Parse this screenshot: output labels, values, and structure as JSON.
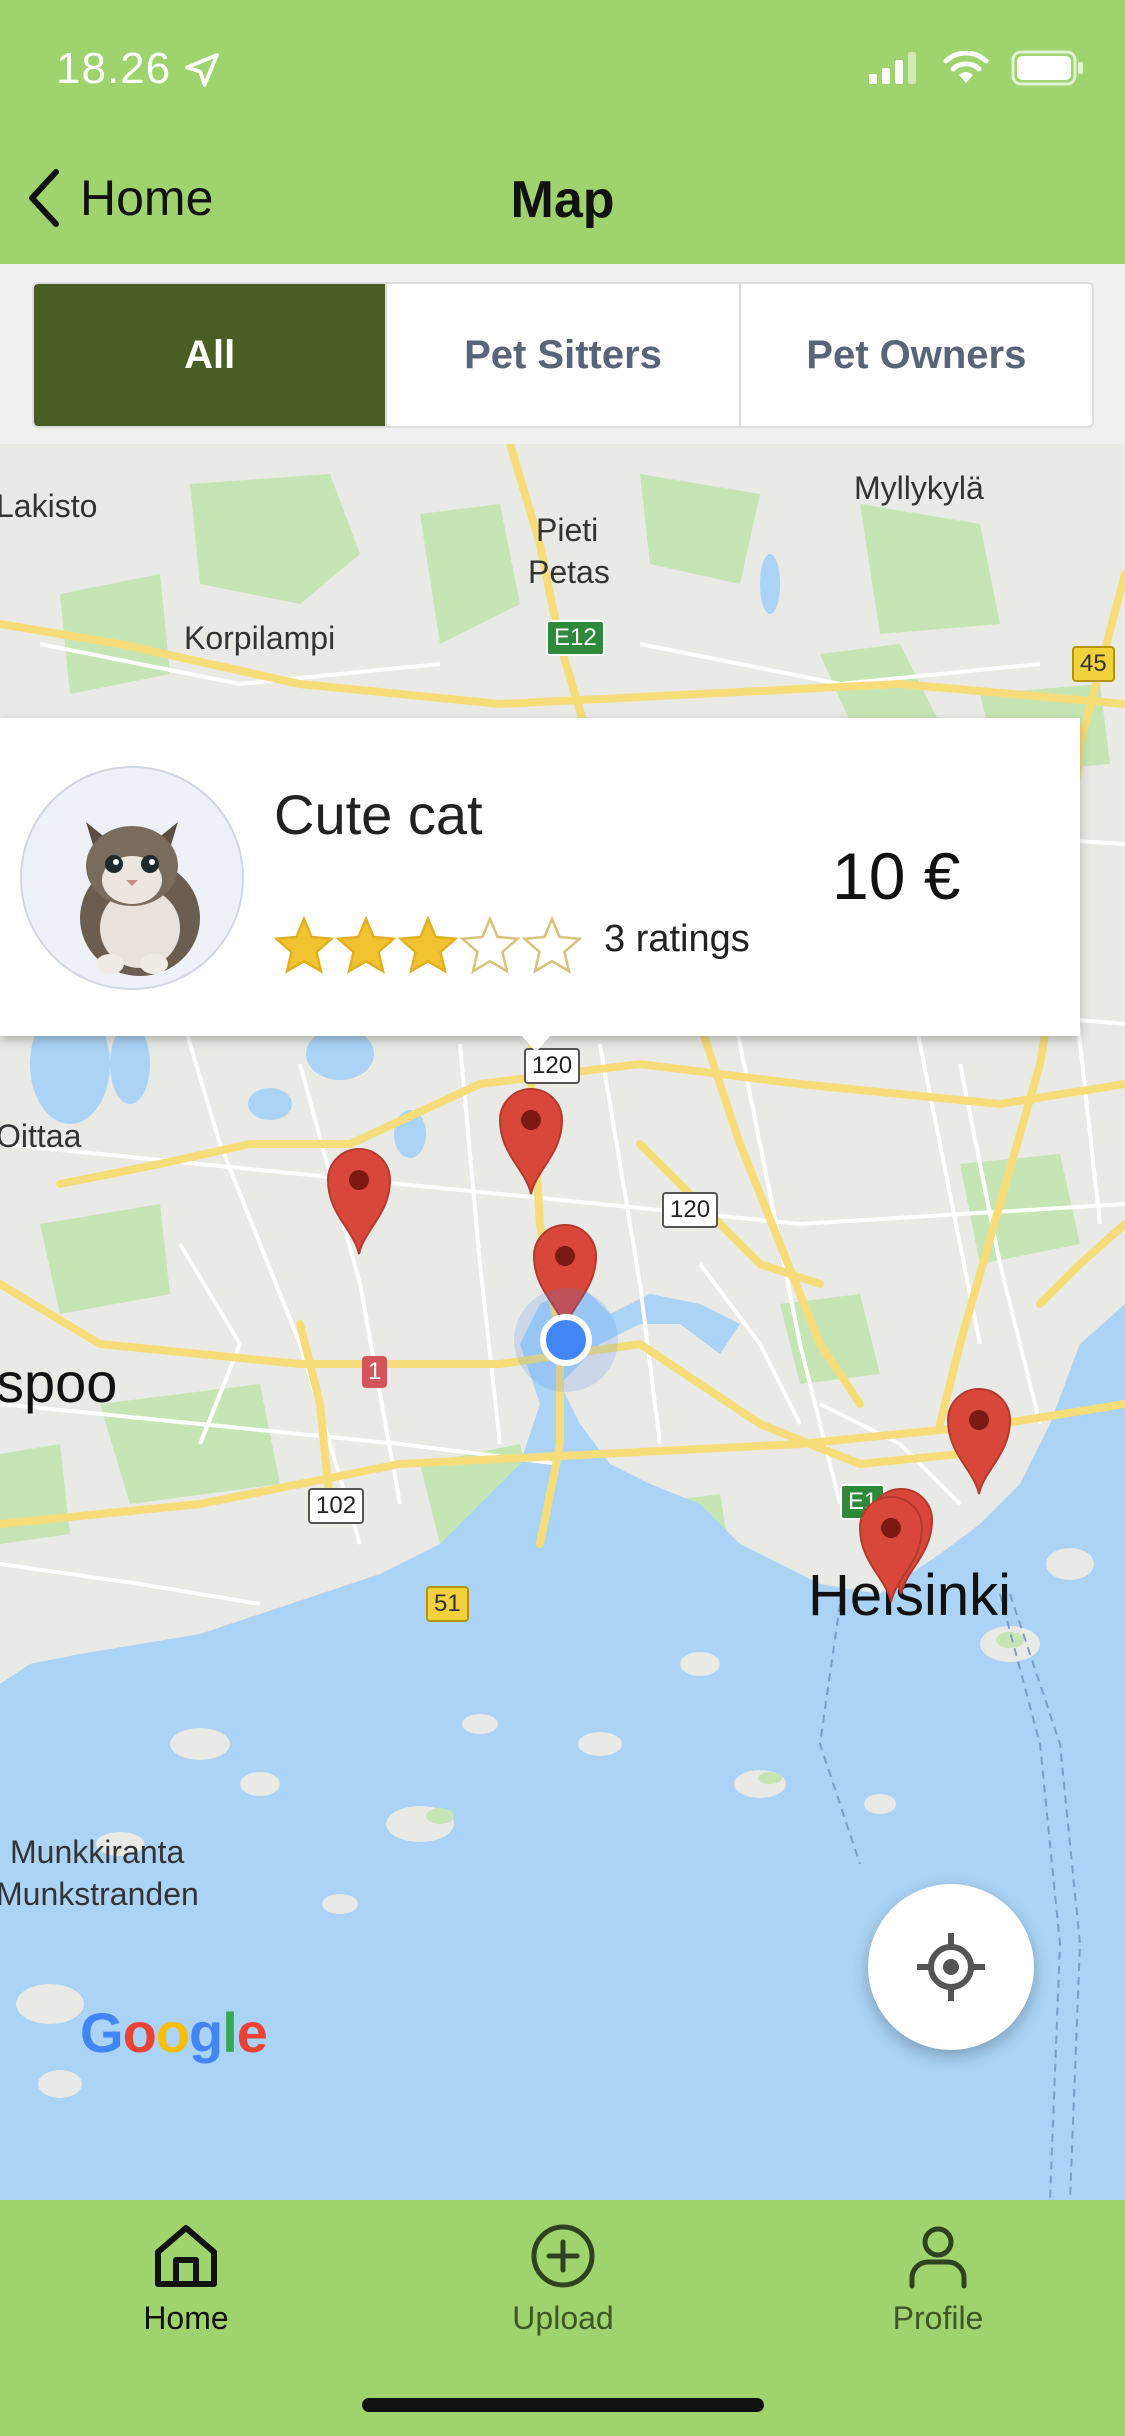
{
  "status_bar": {
    "time": "18.26"
  },
  "nav": {
    "back_label": "Home",
    "title": "Map"
  },
  "segments": [
    {
      "label": "All",
      "active": true
    },
    {
      "label": "Pet Sitters",
      "active": false
    },
    {
      "label": "Pet Owners",
      "active": false
    }
  ],
  "map": {
    "labels": {
      "lakisto": "Lakisto",
      "myllykyla": "Myllykylä",
      "pieti": "Pieti",
      "petas": "Petas",
      "korpilampi": "Korpilampi",
      "oittaa": "Oittaa",
      "espoo": "spoo",
      "helsinki": "Helsinki",
      "munkkiranta": "Munkkiranta",
      "munkstranden": "Munkstranden"
    },
    "shields": {
      "e12_top": "E12",
      "r45": "45",
      "r120_a": "120",
      "r120_b": "120",
      "r1": "1",
      "r102": "102",
      "r51": "51",
      "e18": "E1"
    },
    "google_logo": "Google"
  },
  "callout": {
    "title": "Cute cat",
    "rating": 3,
    "rating_max": 5,
    "ratings_text": "3 ratings",
    "price": "10 €"
  },
  "tabs": [
    {
      "label": "Home",
      "icon": "home-icon",
      "active": true
    },
    {
      "label": "Upload",
      "icon": "plus-circle-icon",
      "active": false
    },
    {
      "label": "Profile",
      "icon": "person-icon",
      "active": false
    }
  ],
  "colors": {
    "header_green": "#9ed36e",
    "segment_active": "#4a5e24",
    "pin_red": "#d9473a",
    "water": "#aad3f5"
  }
}
